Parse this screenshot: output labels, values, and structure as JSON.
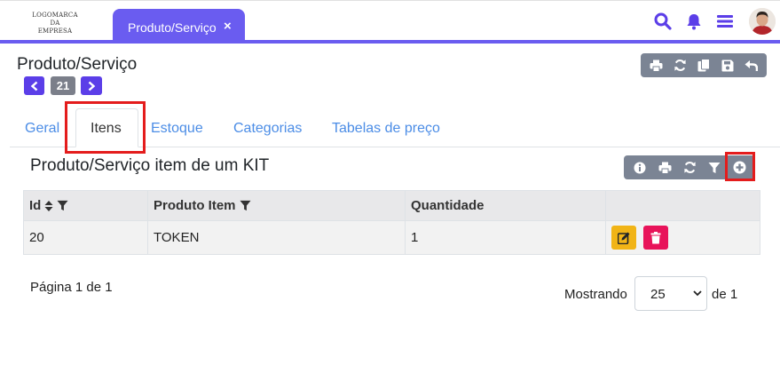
{
  "logo": {
    "line1": "LOGOMARCA",
    "line2": "DA",
    "line3": "EMPRESA"
  },
  "app_tab": {
    "label": "Produto/Serviço",
    "close": "×"
  },
  "header_icons": [
    "search-icon",
    "bell-icon",
    "menu-icon",
    "avatar"
  ],
  "page": {
    "title": "Produto/Serviço",
    "record_number": "21"
  },
  "top_toolbar": [
    "print-icon",
    "refresh-icon",
    "copy-icon",
    "save-icon",
    "undo-icon"
  ],
  "tabs": [
    {
      "label": "Geral"
    },
    {
      "label": "Itens",
      "active": true
    },
    {
      "label": "Estoque"
    },
    {
      "label": "Categorias"
    },
    {
      "label": "Tabelas de preço"
    }
  ],
  "section": {
    "title": "Produto/Serviço item de um KIT",
    "toolbar": [
      "info-icon",
      "print-icon",
      "refresh-icon",
      "filter-icon",
      "add-icon"
    ]
  },
  "table": {
    "columns": [
      {
        "label": "Id"
      },
      {
        "label": "Produto Item"
      },
      {
        "label": "Quantidade"
      },
      {
        "label": ""
      }
    ],
    "rows": [
      {
        "id": "20",
        "produto_item": "TOKEN",
        "quantidade": "1"
      }
    ]
  },
  "pagination": {
    "page_info": "Página 1 de 1",
    "showing_label": "Mostrando",
    "page_size": "25",
    "of_total": "de 1"
  },
  "colors": {
    "brand": "#6a5cf0",
    "nav_button": "#5b3ee8",
    "toolbar": "#7b8494",
    "link": "#4c8de6",
    "highlight": "#e41c1c",
    "edit": "#f1b416",
    "delete": "#e8135a"
  }
}
